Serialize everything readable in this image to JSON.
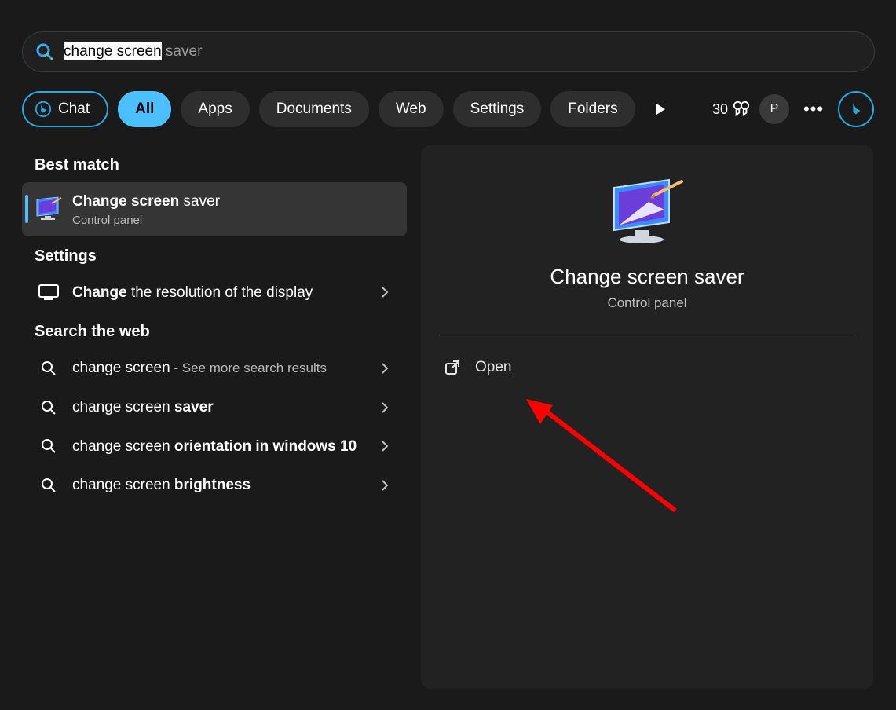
{
  "search": {
    "typed": "change screen",
    "suggestion_suffix": " saver"
  },
  "filters": {
    "chat": "Chat",
    "all": "All",
    "apps": "Apps",
    "documents": "Documents",
    "web": "Web",
    "settings": "Settings",
    "folders": "Folders"
  },
  "rewards": {
    "points": "30"
  },
  "profile": {
    "initial": "P"
  },
  "left": {
    "best_match_label": "Best match",
    "best_match": {
      "title_bold": "Change screen",
      "title_rest": " saver",
      "subtitle": "Control panel"
    },
    "settings_label": "Settings",
    "settings_items": [
      {
        "title_bold": "Change",
        "title_rest": " the resolution of the display"
      }
    ],
    "web_label": "Search the web",
    "web_items": [
      {
        "prefix": "change screen",
        "extra": " - See more search results",
        "bold_suffix": ""
      },
      {
        "prefix": "change screen ",
        "extra": "",
        "bold_suffix": "saver"
      },
      {
        "prefix": "change screen ",
        "extra": "",
        "bold_suffix": "orientation in windows 10"
      },
      {
        "prefix": "change screen ",
        "extra": "",
        "bold_suffix": "brightness"
      }
    ]
  },
  "preview": {
    "title": "Change screen saver",
    "subtitle": "Control panel",
    "action_open": "Open"
  }
}
